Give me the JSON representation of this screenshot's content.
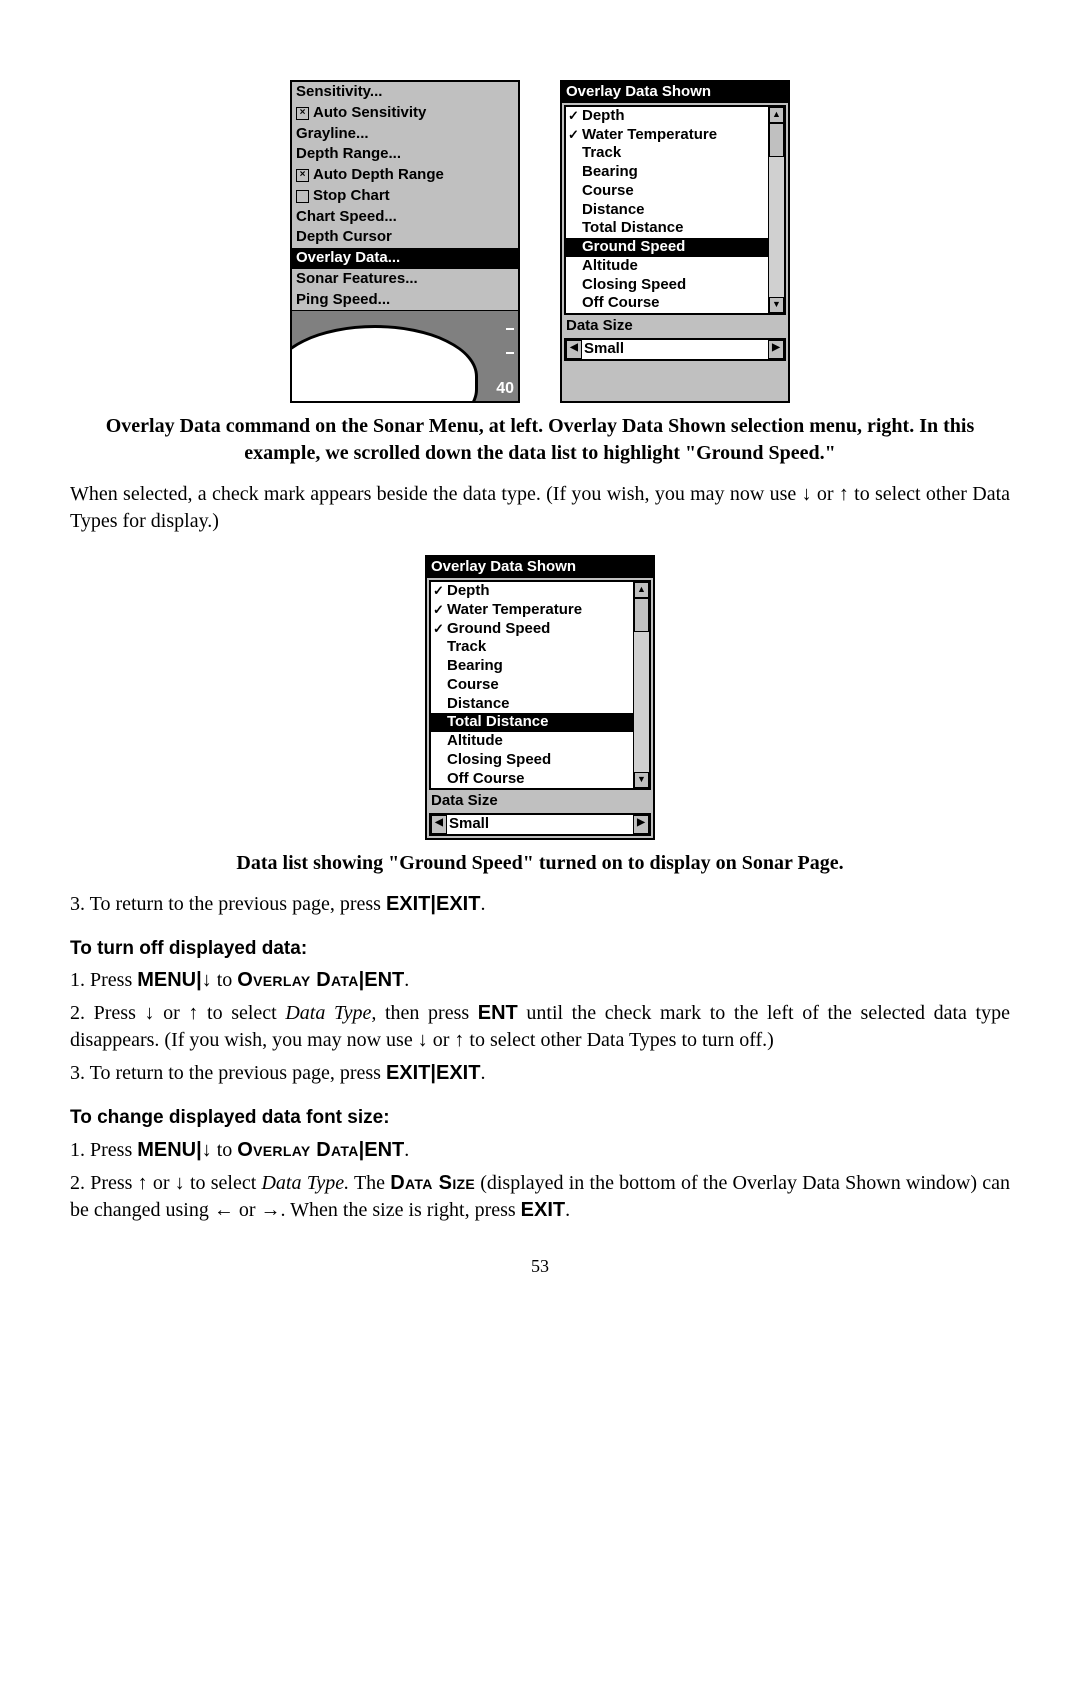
{
  "figure1": {
    "sonar_menu": {
      "items": [
        {
          "label": "Sensitivity...",
          "checkbox": false,
          "checked": false,
          "selected": false
        },
        {
          "label": "Auto Sensitivity",
          "checkbox": true,
          "checked": true,
          "selected": false
        },
        {
          "label": "Grayline...",
          "checkbox": false,
          "checked": false,
          "selected": false
        },
        {
          "label": "Depth Range...",
          "checkbox": false,
          "checked": false,
          "selected": false
        },
        {
          "label": "Auto Depth Range",
          "checkbox": true,
          "checked": true,
          "selected": false
        },
        {
          "label": "Stop Chart",
          "checkbox": true,
          "checked": false,
          "selected": false
        },
        {
          "label": "Chart Speed...",
          "checkbox": false,
          "checked": false,
          "selected": false
        },
        {
          "label": "Depth Cursor",
          "checkbox": false,
          "checked": false,
          "selected": false
        },
        {
          "label": "Overlay Data...",
          "checkbox": false,
          "checked": false,
          "selected": true
        },
        {
          "label": "Sonar Features...",
          "checkbox": false,
          "checked": false,
          "selected": false
        },
        {
          "label": "Ping Speed...",
          "checkbox": false,
          "checked": false,
          "selected": false
        }
      ],
      "depth_value": "40"
    },
    "ods_panel": {
      "title": "Overlay Data Shown",
      "rows": [
        {
          "label": "Depth",
          "checked": true,
          "selected": false
        },
        {
          "label": "Water Temperature",
          "checked": true,
          "selected": false
        },
        {
          "label": "Track",
          "checked": false,
          "selected": false
        },
        {
          "label": "Bearing",
          "checked": false,
          "selected": false
        },
        {
          "label": "Course",
          "checked": false,
          "selected": false
        },
        {
          "label": "Distance",
          "checked": false,
          "selected": false
        },
        {
          "label": "Total Distance",
          "checked": false,
          "selected": false
        },
        {
          "label": "Ground Speed",
          "checked": false,
          "selected": true
        },
        {
          "label": "Altitude",
          "checked": false,
          "selected": false
        },
        {
          "label": "Closing Speed",
          "checked": false,
          "selected": false
        },
        {
          "label": "Off Course",
          "checked": false,
          "selected": false
        }
      ],
      "data_size_label": "Data Size",
      "data_size_value": "Small"
    }
  },
  "caption1": "Overlay Data command on the Sonar Menu, at left. Overlay Data Shown selection menu, right. In this example, we scrolled down the data list to highlight \"Ground Speed.\"",
  "para1a": "When selected, a check mark appears beside the data type. (If you wish, you may now use ",
  "para1b": " or ",
  "para1c": " to select other Data Types for display.)",
  "figure2": {
    "title": "Overlay Data Shown",
    "rows": [
      {
        "label": "Depth",
        "checked": true,
        "selected": false
      },
      {
        "label": "Water Temperature",
        "checked": true,
        "selected": false
      },
      {
        "label": "Ground Speed",
        "checked": true,
        "selected": false
      },
      {
        "label": "Track",
        "checked": false,
        "selected": false
      },
      {
        "label": "Bearing",
        "checked": false,
        "selected": false
      },
      {
        "label": "Course",
        "checked": false,
        "selected": false
      },
      {
        "label": "Distance",
        "checked": false,
        "selected": false
      },
      {
        "label": "Total Distance",
        "checked": false,
        "selected": true
      },
      {
        "label": "Altitude",
        "checked": false,
        "selected": false
      },
      {
        "label": "Closing Speed",
        "checked": false,
        "selected": false
      },
      {
        "label": "Off Course",
        "checked": false,
        "selected": false
      }
    ],
    "data_size_label": "Data Size",
    "data_size_value": "Small"
  },
  "caption2": "Data list showing \"Ground Speed\" turned on to display on Sonar Page.",
  "step3a": "3. To return to the previous page, press ",
  "exit": "EXIT",
  "pipe": "|",
  "head_turn_off": "To turn off displayed data:",
  "step_off_1a": "1. Press ",
  "menu": "MENU",
  "to": " to ",
  "overlay_data": "Overlay Data",
  "ent": "ENT",
  "step_off_2a": "2. Press ",
  "step_off_2b": " or ",
  "step_off_2c": " to select ",
  "data_type_it": "Data Type,",
  "step_off_2d": " then press ",
  "step_off_2e": " until the check mark to the left of the selected data type disappears. (If you wish, you may now use ",
  "step_off_2f": " or ",
  "step_off_2g": " to select other Data Types to turn off.)",
  "head_font_size": "To change displayed data font size:",
  "step_size_2a": "2. Press ",
  "step_size_2b": " or ",
  "step_size_2c": " to select ",
  "data_type_it2": "Data Type.",
  "step_size_2d": " The ",
  "data_size_sc": "Data Size",
  "step_size_2e": " (displayed in the bottom of the Overlay Data Shown window) can be changed using ",
  "step_size_2f": " or ",
  "step_size_2g": ". When the size is right, press ",
  "page_number": "53",
  "arrows": {
    "down": "↓",
    "up": "↑",
    "left": "←",
    "right": "→"
  }
}
